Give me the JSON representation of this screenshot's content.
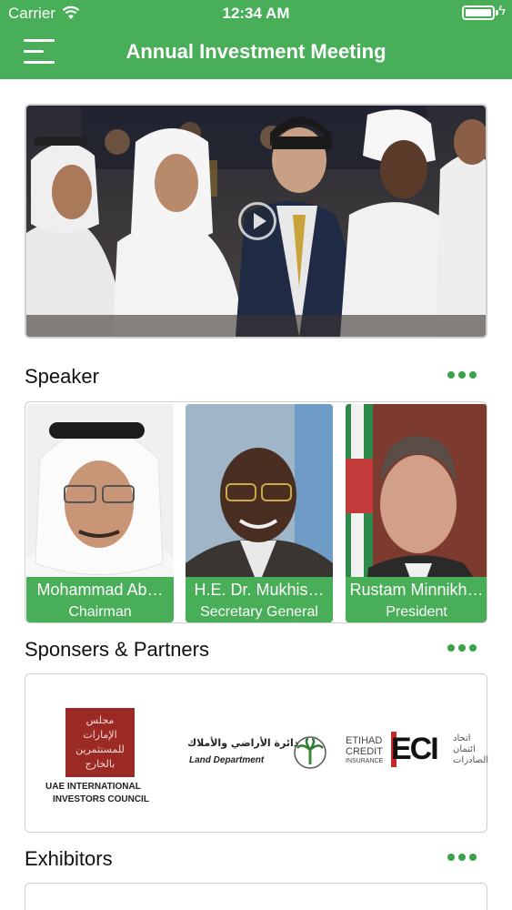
{
  "status_bar": {
    "carrier": "Carrier",
    "time": "12:34 AM"
  },
  "header": {
    "title": "Annual Investment Meeting"
  },
  "sections": {
    "speaker": "Speaker",
    "sponsors": "Sponsers & Partners",
    "exhibitors": "Exhibitors"
  },
  "speakers": [
    {
      "name": "Mohammad Ab…",
      "role": "Chairman"
    },
    {
      "name": "H.E. Dr. Mukhis…",
      "role": "Secretary General"
    },
    {
      "name": "Rustam Minnikh…",
      "role": "President"
    }
  ],
  "sponsors": {
    "uae_council": {
      "arabic": "مجلس الإمارات للمستثمرين بالخارج",
      "english_line1": "UAE INTERNATIONAL",
      "english_line2": "INVESTORS COUNCIL"
    },
    "land_department": {
      "arabic": "دائرة الأراضي والأملاك",
      "english": "Land Department"
    },
    "etihad_credit": {
      "line1": "ETIHAD",
      "line2": "CREDIT",
      "line3": "INSURANCE",
      "mark": "ECI",
      "arabic": "اتحاد ائتمان الصادرات"
    }
  },
  "colors": {
    "primary": "#48ae58",
    "dots": "#3aa34c"
  },
  "icons": [
    "menu-icon",
    "wifi-icon",
    "battery-icon",
    "play-icon",
    "more-dots-icon"
  ]
}
